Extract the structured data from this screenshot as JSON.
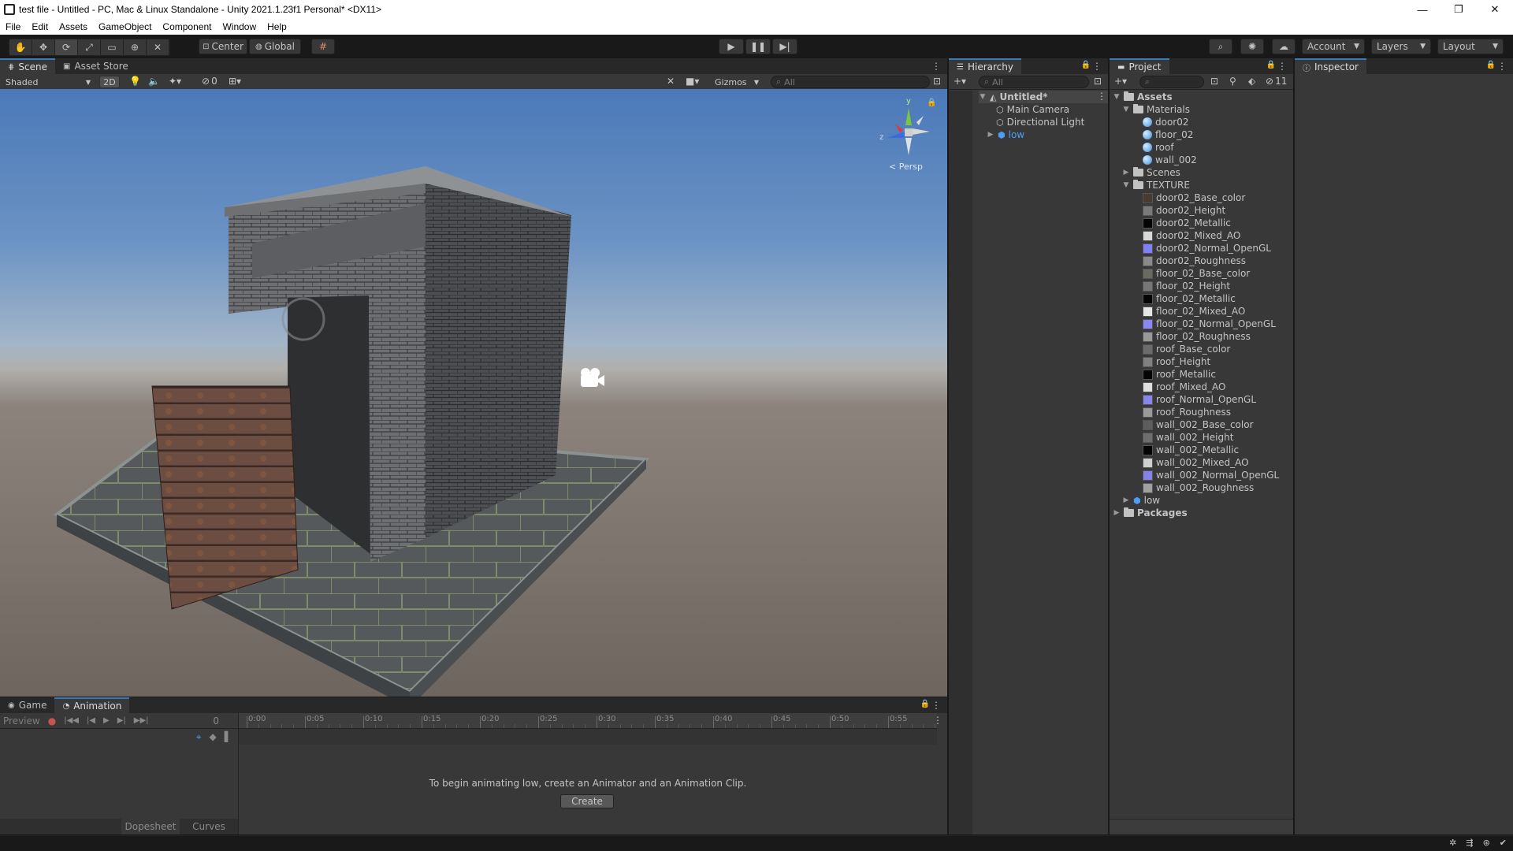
{
  "window": {
    "title": "test file - Untitled - PC, Mac & Linux Standalone - Unity 2021.1.23f1 Personal* <DX11>",
    "controls": [
      "—",
      "❐",
      "✕"
    ]
  },
  "menu": [
    "File",
    "Edit",
    "Assets",
    "GameObject",
    "Component",
    "Window",
    "Help"
  ],
  "toolbar": {
    "pivot": "Center",
    "space": "Global",
    "account": "Account",
    "layers": "Layers",
    "layout": "Layout"
  },
  "scene_panel": {
    "tabs": [
      "Scene",
      "Asset Store"
    ],
    "shading": "Shaded",
    "mode_2d": "2D",
    "hidden_count": "0",
    "gizmos": "Gizmos",
    "search_placeholder": "All",
    "gizmo_axes": {
      "y": "y",
      "z": "z"
    },
    "projection": "< Persp"
  },
  "hierarchy": {
    "tab": "Hierarchy",
    "search_placeholder": "All",
    "scene_name": "Untitled*",
    "items": [
      "Main Camera",
      "Directional Light",
      "low"
    ]
  },
  "project": {
    "tab": "Project",
    "hidden_count": "11",
    "root": "Assets",
    "materials_folder": "Materials",
    "materials": [
      "door02",
      "floor_02",
      "roof",
      "wall_002"
    ],
    "scenes_folder": "Scenes",
    "texture_folder": "TEXTURE",
    "textures": [
      {
        "name": "door02_Base_color",
        "color": "#4a3b32"
      },
      {
        "name": "door02_Height",
        "color": "#7a7a7a"
      },
      {
        "name": "door02_Metallic",
        "color": "#050505"
      },
      {
        "name": "door02_Mixed_AO",
        "color": "#d8d8d8"
      },
      {
        "name": "door02_Normal_OpenGL",
        "color": "#8080ff"
      },
      {
        "name": "door02_Roughness",
        "color": "#8a8a8a"
      },
      {
        "name": "floor_02_Base_color",
        "color": "#6a6a62"
      },
      {
        "name": "floor_02_Height",
        "color": "#777777"
      },
      {
        "name": "floor_02_Metallic",
        "color": "#050505"
      },
      {
        "name": "floor_02_Mixed_AO",
        "color": "#e6e6e6"
      },
      {
        "name": "floor_02_Normal_OpenGL",
        "color": "#8a86f5"
      },
      {
        "name": "floor_02_Roughness",
        "color": "#999999"
      },
      {
        "name": "roof_Base_color",
        "color": "#6c6c6c"
      },
      {
        "name": "roof_Height",
        "color": "#808080"
      },
      {
        "name": "roof_Metallic",
        "color": "#050505"
      },
      {
        "name": "roof_Mixed_AO",
        "color": "#e0e0e0"
      },
      {
        "name": "roof_Normal_OpenGL",
        "color": "#8884f2"
      },
      {
        "name": "roof_Roughness",
        "color": "#9a9a9a"
      },
      {
        "name": "wall_002_Base_color",
        "color": "#5d5d5d"
      },
      {
        "name": "wall_002_Height",
        "color": "#6e6e6e"
      },
      {
        "name": "wall_002_Metallic",
        "color": "#050505"
      },
      {
        "name": "wall_002_Mixed_AO",
        "color": "#cfcfcf"
      },
      {
        "name": "wall_002_Normal_OpenGL",
        "color": "#8680ee"
      },
      {
        "name": "wall_002_Roughness",
        "color": "#a0a0a0"
      }
    ],
    "model": "low",
    "packages": "Packages"
  },
  "inspector": {
    "tab": "Inspector"
  },
  "animation_panel": {
    "tabs": [
      "Game",
      "Animation"
    ],
    "preview": "Preview",
    "frame": "0",
    "timeline_labels": [
      "0:00",
      "0:05",
      "0:10",
      "0:15",
      "0:20",
      "0:25",
      "0:30",
      "0:35",
      "0:40",
      "0:45",
      "0:50",
      "0:55"
    ],
    "message": "To begin animating low, create an Animator and an Animation Clip.",
    "create_button": "Create",
    "dopesheet": "Dopesheet",
    "curves": "Curves"
  },
  "colors": {
    "selection_blue": "#4a9ff5",
    "accent_tab": "#3a79bb"
  }
}
